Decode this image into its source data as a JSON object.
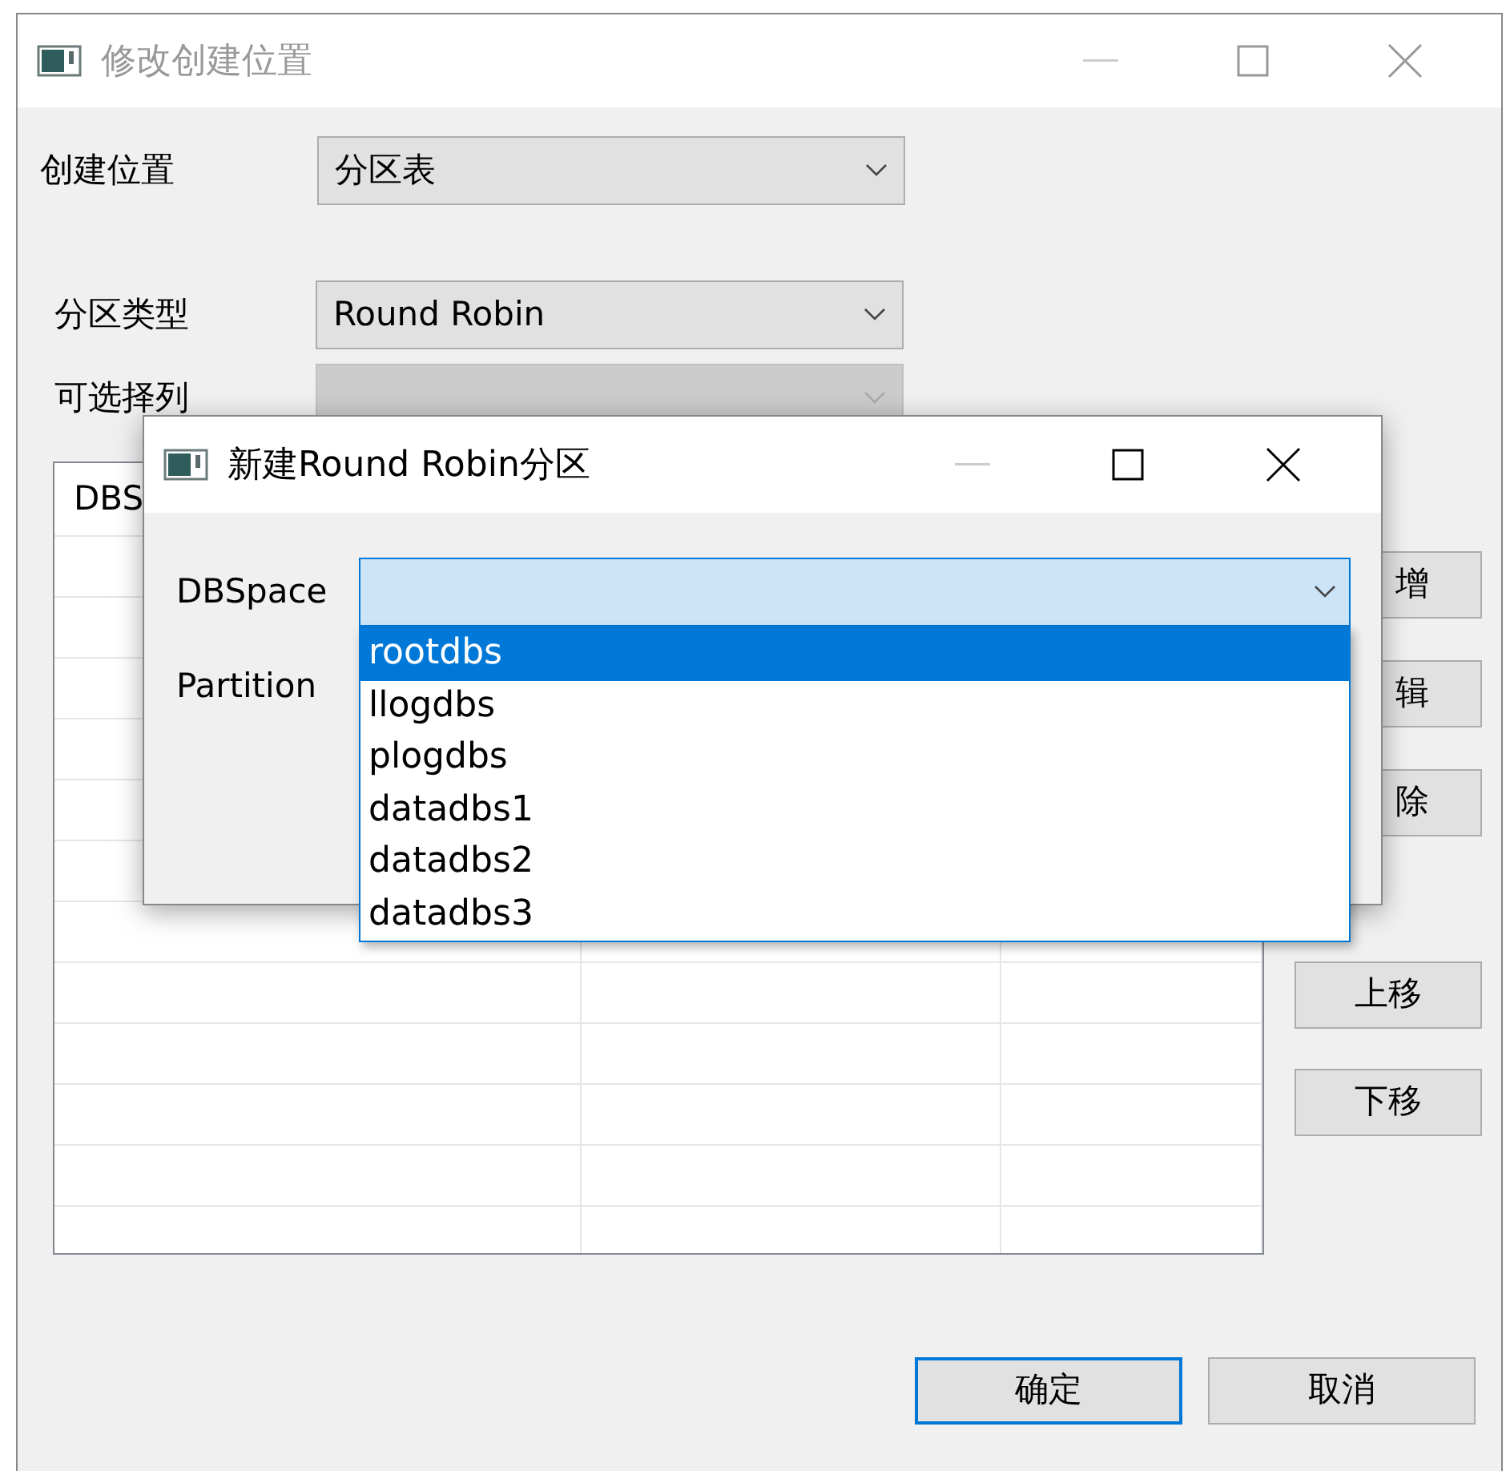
{
  "window": {
    "title": "修改创建位置",
    "active": false
  },
  "fields": [
    {
      "label": "创建位置",
      "value": "分区表",
      "disabled": false
    },
    {
      "label": "分区类型",
      "value": "Round Robin",
      "disabled": false
    },
    {
      "label": "可选择列",
      "disabled": true
    }
  ],
  "table": {
    "columns": [
      "DBS"
    ]
  },
  "side_buttons": [
    {
      "label": "增"
    },
    {
      "label": "辑"
    },
    {
      "label": "除"
    },
    {
      "label": "上移"
    },
    {
      "label": "下移"
    }
  ],
  "buttons": [
    {
      "label": "确定",
      "focused": true
    },
    {
      "label": "取消",
      "focused": false
    }
  ],
  "dialog": {
    "title": "新建Round Robin分区",
    "active": true,
    "fields": [
      {
        "label": "DBSpace",
        "kind": "combo",
        "expanded": true
      },
      {
        "label": "Partition",
        "kind": "label"
      }
    ],
    "dropdown": [
      {
        "label": "rootdbs",
        "selected": true
      },
      {
        "label": "llogdbs",
        "selected": false
      },
      {
        "label": "plogdbs",
        "selected": false
      },
      {
        "label": "datadbs1",
        "selected": false
      },
      {
        "label": "datadbs2",
        "selected": false
      },
      {
        "label": "datadbs3",
        "selected": false
      }
    ]
  }
}
